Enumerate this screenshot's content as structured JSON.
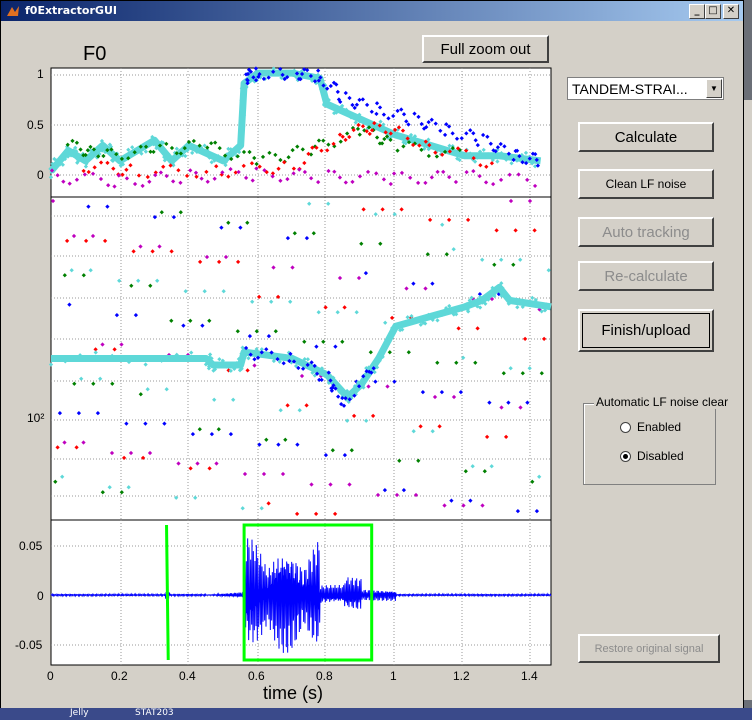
{
  "window": {
    "title": "f0ExtractorGUI"
  },
  "buttons": {
    "full_zoom_out": "Full zoom out",
    "calculate": "Calculate",
    "clean_lf_noise": "Clean LF noise",
    "auto_tracking": "Auto tracking",
    "recalculate": "Re-calculate",
    "finish_upload": "Finish/upload",
    "restore_signal": "Restore original signal"
  },
  "dropdown": {
    "selected": "TANDEM-STRAI..."
  },
  "lf_group": {
    "title": "Automatic LF noise clear",
    "enabled_label": "Enabled",
    "disabled_label": "Disabled",
    "selected": "Disabled"
  },
  "taskbar": {
    "items": [
      "Jelly",
      "STAT203"
    ]
  },
  "colors": {
    "accent_cyan": "#5ed8d8",
    "blue": "#0000ff",
    "red": "#ff0000",
    "green": "#008000",
    "magenta": "#bf00bf",
    "envelope": "#00ff00"
  },
  "chart_data": [
    {
      "type": "scatter",
      "title": "F0",
      "y_ticks": [
        "1",
        "0.5",
        "0"
      ],
      "ylim": [
        -0.2,
        1.05
      ],
      "xlim": [
        0,
        1.45
      ],
      "series": [
        {
          "color": "#5ed8d8",
          "points": [
            [
              0.0,
              0.05
            ],
            [
              0.05,
              0.25
            ],
            [
              0.1,
              0.15
            ],
            [
              0.15,
              0.3
            ],
            [
              0.2,
              0.15
            ],
            [
              0.3,
              0.35
            ],
            [
              0.35,
              0.15
            ],
            [
              0.4,
              0.3
            ],
            [
              0.5,
              0.15
            ],
            [
              0.55,
              0.3
            ],
            [
              0.56,
              0.9
            ],
            [
              0.6,
              1.0
            ],
            [
              0.7,
              1.0
            ],
            [
              0.78,
              0.95
            ],
            [
              0.8,
              0.7
            ],
            [
              0.9,
              0.55
            ],
            [
              1.0,
              0.4
            ],
            [
              1.1,
              0.3
            ],
            [
              1.2,
              0.2
            ],
            [
              1.3,
              0.2
            ],
            [
              1.42,
              0.15
            ]
          ]
        },
        {
          "color": "#0000ff",
          "points": [
            [
              0.56,
              0.95
            ],
            [
              0.6,
              1.0
            ],
            [
              0.7,
              1.0
            ],
            [
              0.78,
              0.97
            ],
            [
              0.85,
              0.75
            ],
            [
              0.95,
              0.65
            ],
            [
              1.05,
              0.55
            ],
            [
              1.15,
              0.45
            ],
            [
              1.25,
              0.35
            ],
            [
              1.35,
              0.2
            ],
            [
              1.42,
              0.15
            ]
          ]
        },
        {
          "color": "#008000",
          "points": [
            [
              0.05,
              0.3
            ],
            [
              0.15,
              0.2
            ],
            [
              0.3,
              0.25
            ],
            [
              0.45,
              0.3
            ],
            [
              0.6,
              0.15
            ],
            [
              0.75,
              0.25
            ],
            [
              0.9,
              0.45
            ],
            [
              1.0,
              0.3
            ],
            [
              1.2,
              0.2
            ]
          ]
        },
        {
          "color": "#ff0000",
          "points": [
            [
              0.1,
              0.1
            ],
            [
              0.25,
              0.05
            ],
            [
              0.5,
              0.05
            ],
            [
              0.7,
              0.1
            ],
            [
              0.85,
              0.4
            ],
            [
              0.95,
              0.5
            ],
            [
              1.1,
              0.3
            ],
            [
              1.3,
              0.1
            ]
          ]
        },
        {
          "color": "#bf00bf",
          "points": [
            [
              0.0,
              0.0
            ],
            [
              0.2,
              -0.05
            ],
            [
              0.4,
              0.0
            ],
            [
              0.6,
              0.02
            ],
            [
              0.8,
              0.0
            ],
            [
              1.0,
              -0.02
            ],
            [
              1.2,
              0.0
            ],
            [
              1.42,
              -0.05
            ]
          ]
        }
      ]
    },
    {
      "type": "scatter",
      "y_ticks": [
        "10²"
      ],
      "ylim": [
        0,
        1
      ],
      "xlim": [
        0,
        1.45
      ],
      "series": [
        {
          "color": "#5ed8d8",
          "points": [
            [
              0.0,
              0.5
            ],
            [
              0.45,
              0.5
            ],
            [
              0.47,
              0.48
            ],
            [
              0.55,
              0.48
            ],
            [
              0.56,
              0.52
            ],
            [
              0.7,
              0.5
            ],
            [
              0.8,
              0.45
            ],
            [
              0.86,
              0.38
            ],
            [
              0.9,
              0.42
            ],
            [
              0.95,
              0.5
            ],
            [
              1.0,
              0.6
            ],
            [
              1.1,
              0.63
            ],
            [
              1.2,
              0.66
            ],
            [
              1.25,
              0.68
            ],
            [
              1.3,
              0.72
            ],
            [
              1.33,
              0.68
            ],
            [
              1.45,
              0.66
            ]
          ]
        },
        {
          "color": "#0000ff",
          "points": [
            [
              0.56,
              0.52
            ],
            [
              0.7,
              0.5
            ],
            [
              0.8,
              0.44
            ],
            [
              0.85,
              0.36
            ],
            [
              0.95,
              0.5
            ]
          ]
        }
      ]
    },
    {
      "type": "line",
      "xlabel": "time (s)",
      "x_ticks": [
        "0",
        "0.2",
        "0.4",
        "0.6",
        "0.8",
        "1",
        "1.2",
        "1.4"
      ],
      "y_ticks": [
        "0.05",
        "0",
        "-0.05"
      ],
      "xlim": [
        0,
        1.45
      ],
      "ylim": [
        -0.07,
        0.075
      ],
      "series": [
        {
          "color": "#0000ff",
          "name": "waveform"
        },
        {
          "color": "#00ff00",
          "name": "envelope",
          "points": [
            [
              0.335,
              0.07
            ],
            [
              0.34,
              -0.065
            ],
            [
              0.56,
              0.07
            ],
            [
              0.93,
              0.07
            ],
            [
              0.93,
              -0.065
            ],
            [
              0.56,
              -0.065
            ]
          ]
        }
      ]
    }
  ]
}
